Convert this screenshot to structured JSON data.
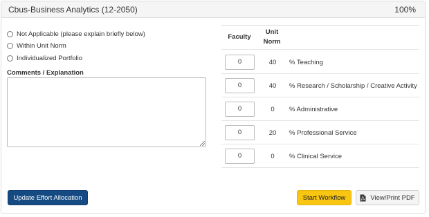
{
  "panel": {
    "title": "Cbus-Business Analytics (12-2050)",
    "percent": "100%"
  },
  "options": [
    {
      "label": "Not Applicable (please explain briefly below)",
      "selected": false
    },
    {
      "label": "Within Unit Norm",
      "selected": false
    },
    {
      "label": "Individualized Portfolio",
      "selected": false
    }
  ],
  "comments": {
    "label": "Comments / Explanation",
    "value": ""
  },
  "table": {
    "headers": {
      "faculty": "Faculty",
      "unit_norm_line1": "Unit",
      "unit_norm_line2": "Norm"
    },
    "rows": [
      {
        "faculty": "0",
        "unit_norm": "40",
        "label": "% Teaching"
      },
      {
        "faculty": "0",
        "unit_norm": "40",
        "label": "% Research / Scholarship / Creative Activity"
      },
      {
        "faculty": "0",
        "unit_norm": "0",
        "label": "% Administrative"
      },
      {
        "faculty": "0",
        "unit_norm": "20",
        "label": "% Professional Service"
      },
      {
        "faculty": "0",
        "unit_norm": "0",
        "label": "% Clinical Service"
      }
    ]
  },
  "buttons": {
    "update": "Update Effort Allocation",
    "start_workflow": "Start Workflow",
    "view_pdf": "View/Print PDF"
  },
  "colors": {
    "primary": "#154b82",
    "warning": "#f7c512",
    "default": "#f4f4f4",
    "heading_bg": "#f5f5f5"
  },
  "icons": {
    "pdf": "file-pdf-icon"
  }
}
